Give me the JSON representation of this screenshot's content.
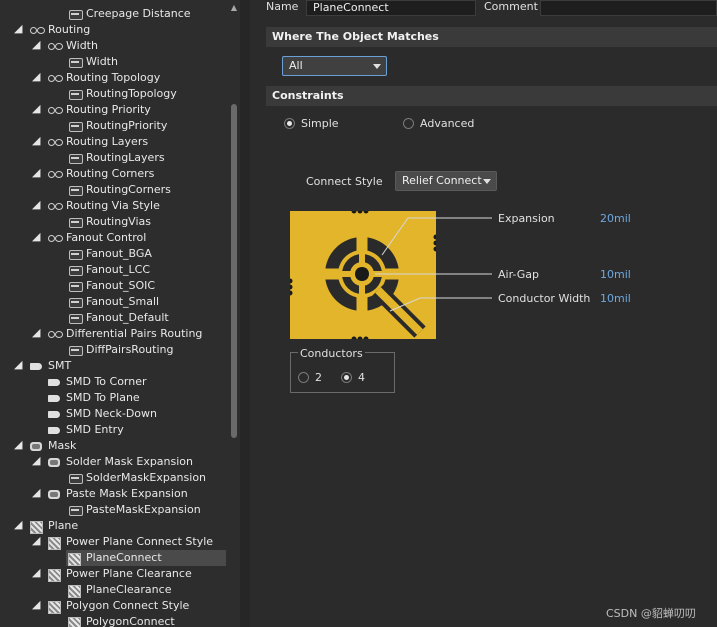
{
  "tree": {
    "rows": [
      {
        "label": "Creepage Distance",
        "indent": 2,
        "icon": "rule-icon",
        "expander": ""
      },
      {
        "label": "Routing",
        "indent": 0,
        "icon": "route-icon",
        "expander": "◢"
      },
      {
        "label": "Width",
        "indent": 1,
        "icon": "route-icon",
        "expander": "◢"
      },
      {
        "label": "Width",
        "indent": 2,
        "icon": "rule-icon",
        "expander": ""
      },
      {
        "label": "Routing Topology",
        "indent": 1,
        "icon": "route-icon",
        "expander": "◢"
      },
      {
        "label": "RoutingTopology",
        "indent": 2,
        "icon": "rule-icon",
        "expander": ""
      },
      {
        "label": "Routing Priority",
        "indent": 1,
        "icon": "route-icon",
        "expander": "◢"
      },
      {
        "label": "RoutingPriority",
        "indent": 2,
        "icon": "rule-icon",
        "expander": ""
      },
      {
        "label": "Routing Layers",
        "indent": 1,
        "icon": "route-icon",
        "expander": "◢"
      },
      {
        "label": "RoutingLayers",
        "indent": 2,
        "icon": "rule-icon",
        "expander": ""
      },
      {
        "label": "Routing Corners",
        "indent": 1,
        "icon": "route-icon",
        "expander": "◢"
      },
      {
        "label": "RoutingCorners",
        "indent": 2,
        "icon": "rule-icon",
        "expander": ""
      },
      {
        "label": "Routing Via Style",
        "indent": 1,
        "icon": "route-icon",
        "expander": "◢"
      },
      {
        "label": "RoutingVias",
        "indent": 2,
        "icon": "rule-icon",
        "expander": ""
      },
      {
        "label": "Fanout Control",
        "indent": 1,
        "icon": "route-icon",
        "expander": "◢"
      },
      {
        "label": "Fanout_BGA",
        "indent": 2,
        "icon": "rule-icon",
        "expander": ""
      },
      {
        "label": "Fanout_LCC",
        "indent": 2,
        "icon": "rule-icon",
        "expander": ""
      },
      {
        "label": "Fanout_SOIC",
        "indent": 2,
        "icon": "rule-icon",
        "expander": ""
      },
      {
        "label": "Fanout_Small",
        "indent": 2,
        "icon": "rule-icon",
        "expander": ""
      },
      {
        "label": "Fanout_Default",
        "indent": 2,
        "icon": "rule-icon",
        "expander": ""
      },
      {
        "label": "Differential Pairs Routing",
        "indent": 1,
        "icon": "route-icon",
        "expander": "◢"
      },
      {
        "label": "DiffPairsRouting",
        "indent": 2,
        "icon": "rule-icon",
        "expander": ""
      },
      {
        "label": "SMT",
        "indent": 0,
        "icon": "smt-icon",
        "expander": "◢"
      },
      {
        "label": "SMD To Corner",
        "indent": 1,
        "icon": "smt-icon",
        "expander": ""
      },
      {
        "label": "SMD To Plane",
        "indent": 1,
        "icon": "smt-icon",
        "expander": ""
      },
      {
        "label": "SMD Neck-Down",
        "indent": 1,
        "icon": "smt-icon",
        "expander": ""
      },
      {
        "label": "SMD Entry",
        "indent": 1,
        "icon": "smt-icon",
        "expander": ""
      },
      {
        "label": "Mask",
        "indent": 0,
        "icon": "mask-icon",
        "expander": "◢"
      },
      {
        "label": "Solder Mask Expansion",
        "indent": 1,
        "icon": "mask-icon",
        "expander": "◢"
      },
      {
        "label": "SolderMaskExpansion",
        "indent": 2,
        "icon": "rule-icon",
        "expander": ""
      },
      {
        "label": "Paste Mask Expansion",
        "indent": 1,
        "icon": "mask-icon",
        "expander": "◢"
      },
      {
        "label": "PasteMaskExpansion",
        "indent": 2,
        "icon": "rule-icon",
        "expander": ""
      },
      {
        "label": "Plane",
        "indent": 0,
        "icon": "plane-icon",
        "expander": "◢"
      },
      {
        "label": "Power Plane Connect Style",
        "indent": 1,
        "icon": "plane-icon",
        "expander": "◢"
      },
      {
        "label": "PlaneConnect",
        "indent": 2,
        "icon": "plane-icon",
        "expander": "",
        "selected": true
      },
      {
        "label": "Power Plane Clearance",
        "indent": 1,
        "icon": "plane-icon",
        "expander": "◢"
      },
      {
        "label": "PlaneClearance",
        "indent": 2,
        "icon": "plane-icon",
        "expander": ""
      },
      {
        "label": "Polygon Connect Style",
        "indent": 1,
        "icon": "plane-icon",
        "expander": "◢"
      },
      {
        "label": "PolygonConnect",
        "indent": 2,
        "icon": "plane-icon",
        "expander": ""
      }
    ]
  },
  "header": {
    "name_label": "Name",
    "name_value": "PlaneConnect",
    "comment_label": "Comment"
  },
  "where": {
    "section_title": "Where The Object Matches",
    "scope_value": "All"
  },
  "constraints": {
    "section_title": "Constraints",
    "mode_simple": "Simple",
    "mode_advanced": "Advanced",
    "connect_style_label": "Connect Style",
    "connect_style_value": "Relief Connect",
    "expansion_label": "Expansion",
    "expansion_value": "20mil",
    "airgap_label": "Air-Gap",
    "airgap_value": "10mil",
    "conductor_width_label": "Conductor Width",
    "conductor_width_value": "10mil",
    "conductors_title": "Conductors",
    "conductors_option_2": "2",
    "conductors_option_4": "4"
  },
  "colors": {
    "diagram_fill": "#e2b52a",
    "accent_value": "#6ea8e0"
  },
  "watermark": "CSDN @貂蝉叨叨"
}
